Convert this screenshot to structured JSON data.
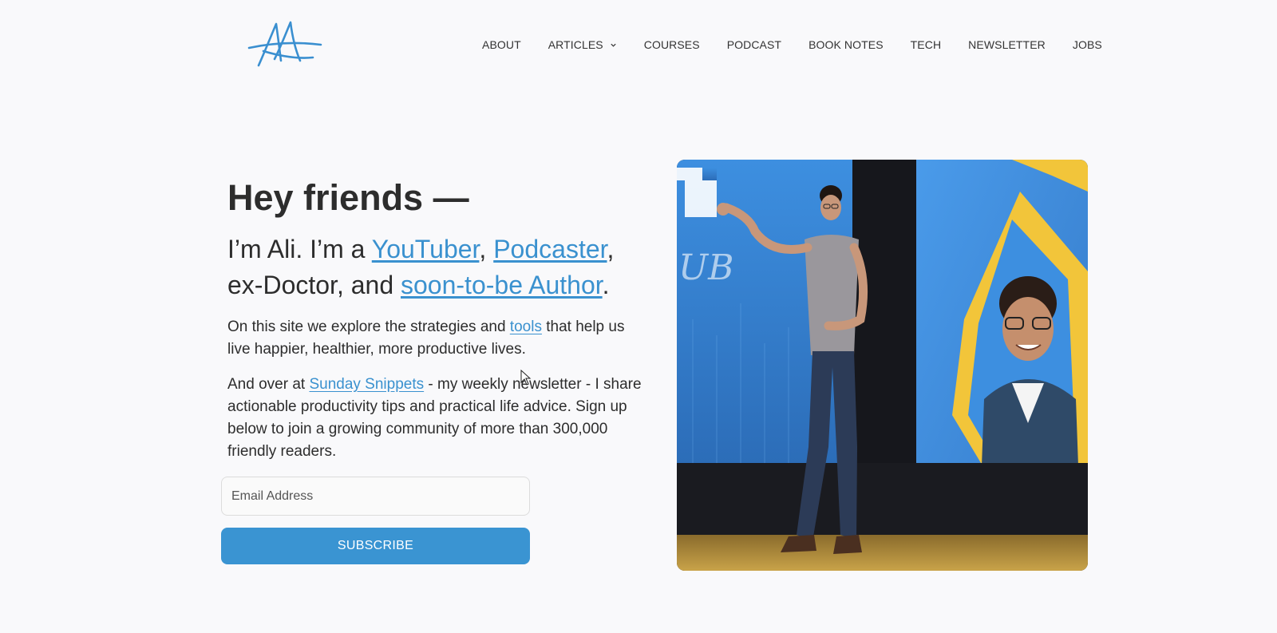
{
  "header": {
    "logo_icon": "signature-logo-icon",
    "nav": [
      {
        "label": "ABOUT"
      },
      {
        "label": "ARTICLES",
        "has_dropdown": true
      },
      {
        "label": "COURSES"
      },
      {
        "label": "PODCAST"
      },
      {
        "label": "BOOK NOTES"
      },
      {
        "label": "TECH"
      },
      {
        "label": "NEWSLETTER"
      },
      {
        "label": "JOBS"
      }
    ]
  },
  "hero": {
    "heading": "Hey friends —",
    "intro": {
      "t1": "I’m Ali. I’m a ",
      "link_youtuber": "YouTuber",
      "t2": ", ",
      "link_podcaster": "Podcaster",
      "t3": ", ex-Doctor, and ",
      "link_author": "soon-to-be Author",
      "t4": "."
    },
    "para1": {
      "t1": "On this site we explore the strategies and ",
      "link_tools": "tools",
      "t2": " that help us live happier, healthier, more productive lives."
    },
    "para2": {
      "t1": "And over at ",
      "link_snippets": "Sunday Snippets",
      "t2": " - my weekly newsletter - I share actionable productivity tips and practical life advice. Sign up below to join a growing community of more than 300,000 friendly readers."
    },
    "email_placeholder": "Email Address",
    "subscribe_label": "SUBSCRIBE"
  },
  "colors": {
    "accent": "#3a94d2",
    "link": "#3a91cf",
    "background": "#f9f9fb",
    "stage_blue": "#3d8fe0",
    "stage_yellow": "#f2c53a"
  }
}
